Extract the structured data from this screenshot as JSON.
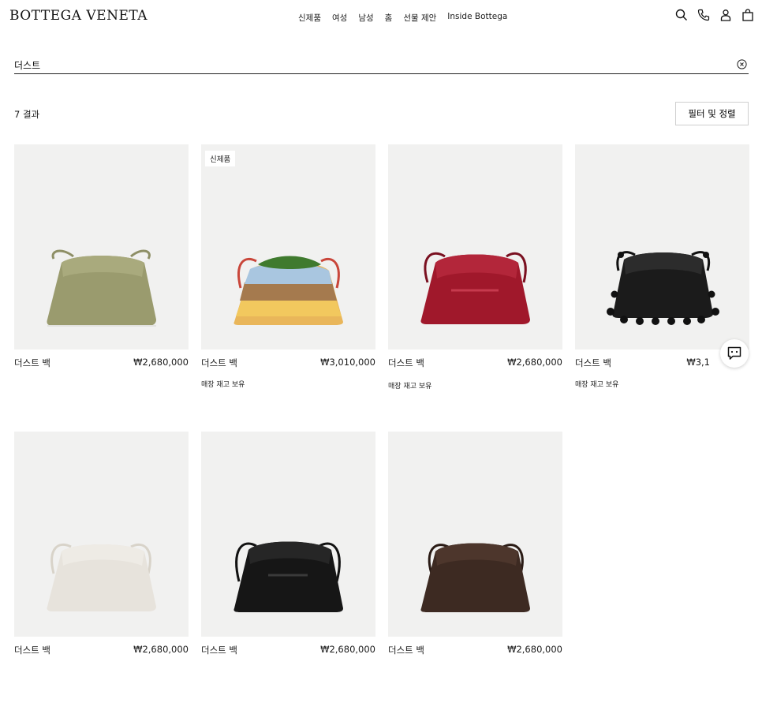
{
  "brand": "BOTTEGA VENETA",
  "nav": [
    "신제품",
    "여성",
    "남성",
    "홈",
    "선물 제안",
    "Inside Bottega"
  ],
  "search": {
    "value": "더스트"
  },
  "results_label": "7 결과",
  "filter_label": "필터 및 정렬",
  "products": [
    {
      "name": "더스트 백",
      "price": "₩2,680,000",
      "badge": "",
      "stock": "",
      "color": "#9a9b6e"
    },
    {
      "name": "더스트 백",
      "price": "₩3,010,000",
      "badge": "신제품",
      "stock": "매장 재고 보유",
      "color": "#d89a4a"
    },
    {
      "name": "더스트 백",
      "price": "₩2,680,000",
      "badge": "",
      "stock": "매장 재고 보유",
      "color": "#a0182b"
    },
    {
      "name": "더스트 백",
      "price": "₩3,1",
      "badge": "",
      "stock": "매장 재고 보유",
      "color": "#1b1b1b"
    },
    {
      "name": "더스트 백",
      "price": "₩2,680,000",
      "badge": "",
      "stock": "",
      "color": "#e7e3dc"
    },
    {
      "name": "더스트 백",
      "price": "₩2,680,000",
      "badge": "",
      "stock": "",
      "color": "#161616"
    },
    {
      "name": "더스트 백",
      "price": "₩2,680,000",
      "badge": "",
      "stock": "",
      "color": "#3d2a22"
    }
  ]
}
